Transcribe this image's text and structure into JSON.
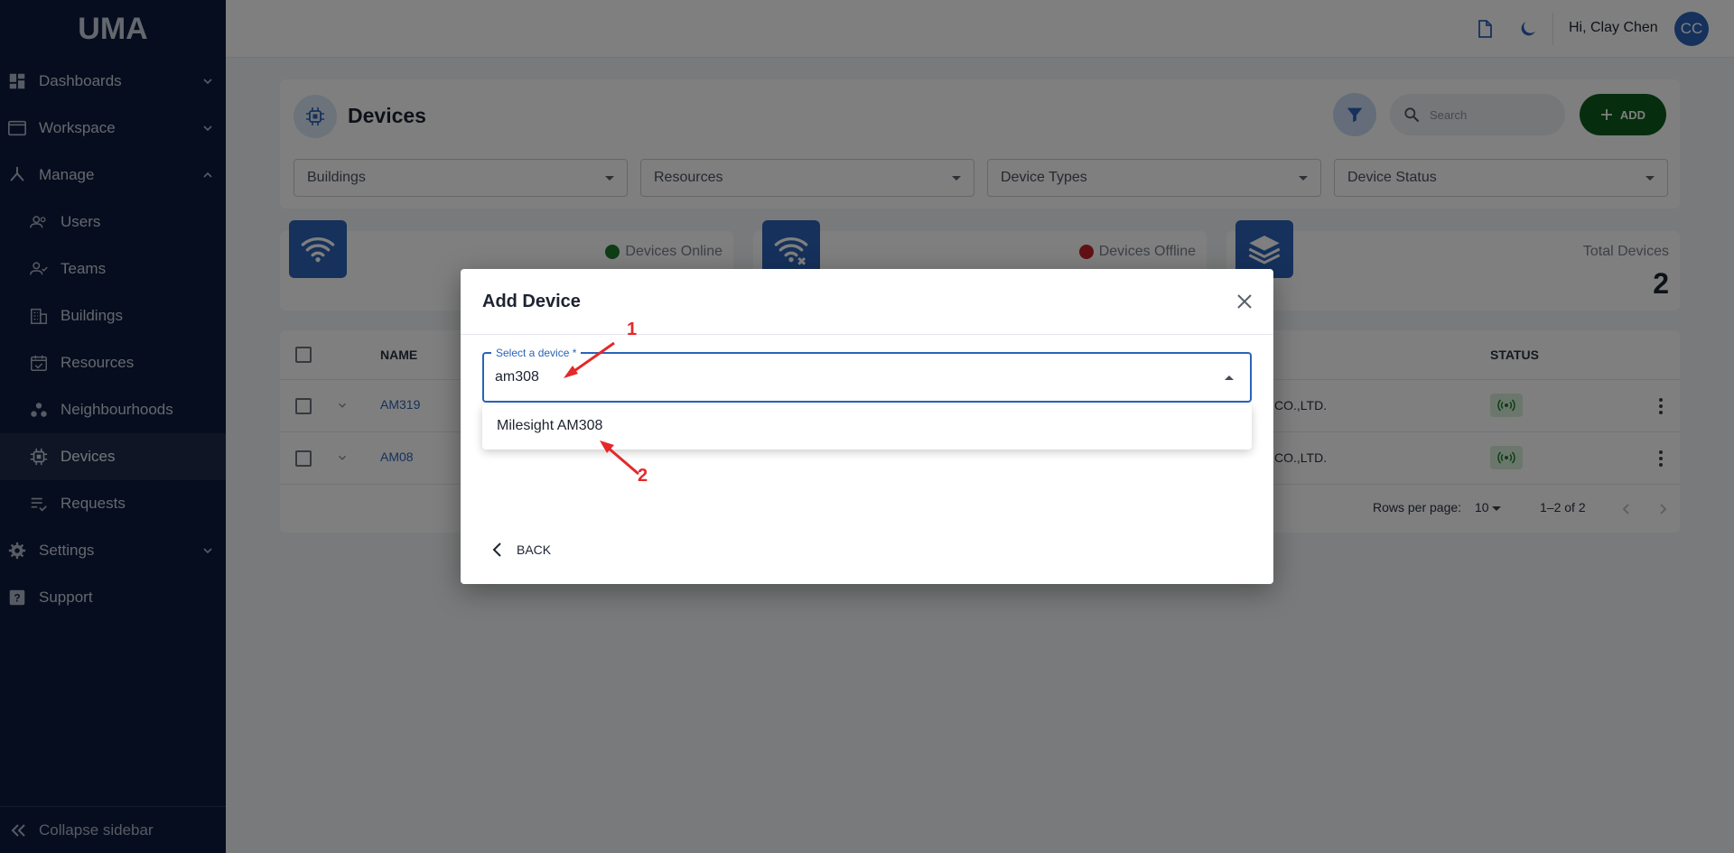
{
  "app": {
    "logo_text": "UMA"
  },
  "sidebar": {
    "items": [
      {
        "label": "Dashboards"
      },
      {
        "label": "Workspace"
      },
      {
        "label": "Manage"
      },
      {
        "label": "Users"
      },
      {
        "label": "Teams"
      },
      {
        "label": "Buildings"
      },
      {
        "label": "Resources"
      },
      {
        "label": "Neighbourhoods"
      },
      {
        "label": "Devices"
      },
      {
        "label": "Requests"
      },
      {
        "label": "Settings"
      },
      {
        "label": "Support"
      }
    ],
    "collapse_label": "Collapse sidebar"
  },
  "topbar": {
    "greeting": "Hi, Clay Chen",
    "avatar_initials": "CC"
  },
  "page": {
    "title": "Devices",
    "search_placeholder": "Search",
    "add_label": "ADD",
    "filters": [
      "Buildings",
      "Resources",
      "Device Types",
      "Device Status"
    ]
  },
  "stats": [
    {
      "label": "Devices Online",
      "dot_color": "#1e7a2d"
    },
    {
      "label": "Devices Offline",
      "dot_color": "#c4222a"
    },
    {
      "label": "Total Devices",
      "value": "2"
    }
  ],
  "table": {
    "headers": {
      "name": "NAME",
      "status": "STATUS"
    },
    "rows": [
      {
        "name": "AM319",
        "manufacturer_fragment": "CO.,LTD."
      },
      {
        "name": "AM08",
        "manufacturer_fragment": "CO.,LTD."
      }
    ],
    "rows_per_page_label": "Rows per page:",
    "rows_per_page_value": "10",
    "range_text": "1–2 of 2"
  },
  "dialog": {
    "title": "Add Device",
    "field_label": "Select a device *",
    "field_value": "am308",
    "options": [
      "Milesight AM308"
    ],
    "back_label": "BACK"
  },
  "annotations": {
    "one": "1",
    "two": "2",
    "color": "#e5282a"
  },
  "colors": {
    "sidebar_bg": "#0d1b3d",
    "accent": "#2a63b8",
    "add_green": "#0c5c1c"
  }
}
